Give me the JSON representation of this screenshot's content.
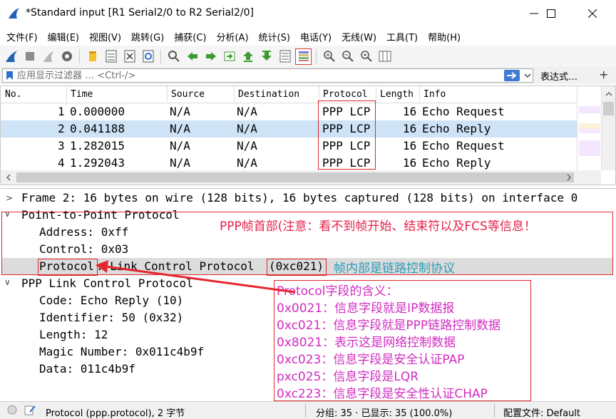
{
  "window": {
    "title": "*Standard input [R1 Serial2/0 to R2 Serial2/0]"
  },
  "menu": [
    "文件(F)",
    "编辑(E)",
    "视图(V)",
    "跳转(G)",
    "捕获(C)",
    "分析(A)",
    "统计(S)",
    "电话(Y)",
    "无线(W)",
    "工具(T)",
    "帮助(H)"
  ],
  "filter": {
    "placeholder": "应用显示过滤器 … <Ctrl-/>",
    "expression_label": "表达式…",
    "plus": "+"
  },
  "packet_list": {
    "columns": [
      "No.",
      "Time",
      "Source",
      "Destination",
      "Protocol",
      "Length",
      "Info"
    ],
    "rows": [
      {
        "no": "1",
        "time": "0.000000",
        "source": "N/A",
        "destination": "N/A",
        "protocol": "PPP LCP",
        "length": "16",
        "info": "Echo Request"
      },
      {
        "no": "2",
        "time": "0.041188",
        "source": "N/A",
        "destination": "N/A",
        "protocol": "PPP LCP",
        "length": "16",
        "info": "Echo Reply"
      },
      {
        "no": "3",
        "time": "1.282015",
        "source": "N/A",
        "destination": "N/A",
        "protocol": "PPP LCP",
        "length": "16",
        "info": "Echo Request"
      },
      {
        "no": "4",
        "time": "1.292043",
        "source": "N/A",
        "destination": "N/A",
        "protocol": "PPP LCP",
        "length": "16",
        "info": "Echo Reply"
      }
    ]
  },
  "details": {
    "frame_line": "Frame 2: 16 bytes on wire (128 bits), 16 bytes captured (128 bits) on interface 0",
    "ppp_header": "Point-to-Point Protocol",
    "address": "Address: 0xff",
    "control": "Control: 0x03",
    "protocol_label": "Protocol",
    "protocol_rest": ": Link Control Protocol",
    "protocol_value": "(0xc021)",
    "lcp_header": "PPP Link Control Protocol",
    "code": "Code: Echo Reply (10)",
    "identifier": "Identifier: 50 (0x32)",
    "length": "Length: 12",
    "magic": "Magic Number: 0x011c4b9f",
    "data": "Data: 011c4b9f"
  },
  "annotations": {
    "ppp_note": "PPP帧首部(注意：看不到帧开始、结束符以及FCS等信息！",
    "frame_inner": "帧内部是链路控制协议",
    "protocol_meaning": [
      "Protocol字段的含义：",
      "0x0021：信息字段就是IP数据报",
      "0xc021：信息字段就是PPP链路控制数据",
      "0x8021：表示这是网络控制数据",
      "0xc023：信息字段是安全认证PAP",
      "pxc025：信息字段是LQR",
      "0xc223：信息字段是安全性认证CHAP"
    ],
    "colors": {
      "red_note": "#e6224a",
      "teal_note": "#2a9bb7",
      "magenta": "#d12cc0",
      "box": "#e0262b",
      "arrow": "#e5262f"
    }
  },
  "status": {
    "field": "Protocol (ppp.protocol), 2 字节",
    "packets": "分组: 35 · 已显示: 35 (100.0%)",
    "profile": "配置文件: Default"
  },
  "colors": {
    "selected_row": "#cfe3f7",
    "selected_detail": "#dcdcdc",
    "apply_blue": "#3b7bd6"
  }
}
